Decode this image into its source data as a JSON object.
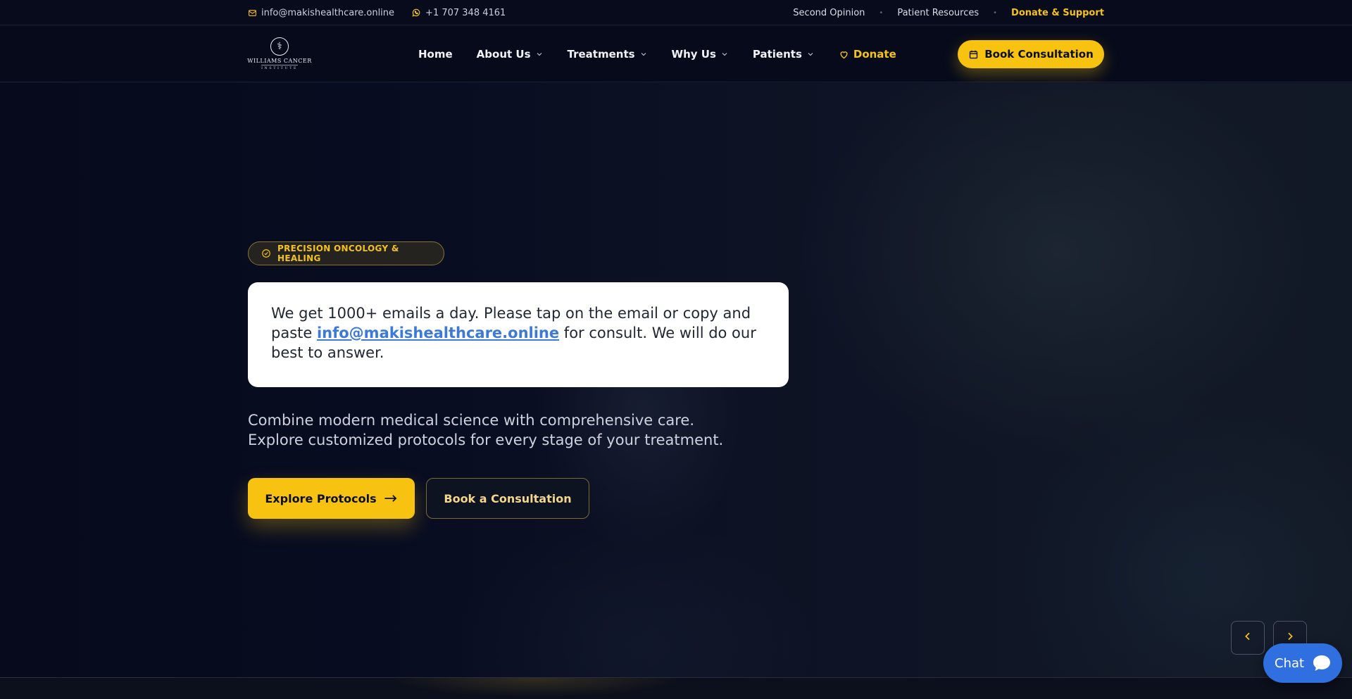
{
  "topbar": {
    "email": "info@makishealthcare.online",
    "phone": "+1 707 348 4161",
    "links": [
      "Second Opinion",
      "Patient Resources"
    ],
    "donate_support": "Donate & Support",
    "separator": "•"
  },
  "logo": {
    "name": "WILLIAMS CANCER",
    "sub": "INSTITUTE"
  },
  "nav": {
    "home": "Home",
    "about": "About Us",
    "treatments": "Treatments",
    "why_us": "Why Us",
    "patients": "Patients",
    "donate": "Donate",
    "book": "Book Consultation"
  },
  "hero": {
    "badge": "PRECISION ONCOLOGY & HEALING",
    "notice_before": "We get 1000+ emails a day. Please tap on the email or copy and paste ",
    "notice_email": "info@makishealthcare.online",
    "notice_after": " for consult. We will do our best to answer.",
    "lead_line1": "Combine modern medical science with comprehensive care.",
    "lead_line2": "Explore customized protocols for every stage of your treatment.",
    "primary_cta": "Explore Protocols",
    "secondary_cta": "Book a Consultation"
  },
  "chat": {
    "label": "Chat"
  },
  "colors": {
    "accent": "#f8c210",
    "background": "#0a0e22",
    "link": "#3b7ad9",
    "chat": "#2f6fe0"
  },
  "icons": [
    "mail-icon",
    "whatsapp-icon",
    "chevron-down-icon",
    "heart-icon",
    "calendar-icon",
    "check-circle-icon",
    "arrow-right-icon",
    "chevron-left-icon",
    "chevron-right-icon",
    "chat-bubble-icon"
  ]
}
